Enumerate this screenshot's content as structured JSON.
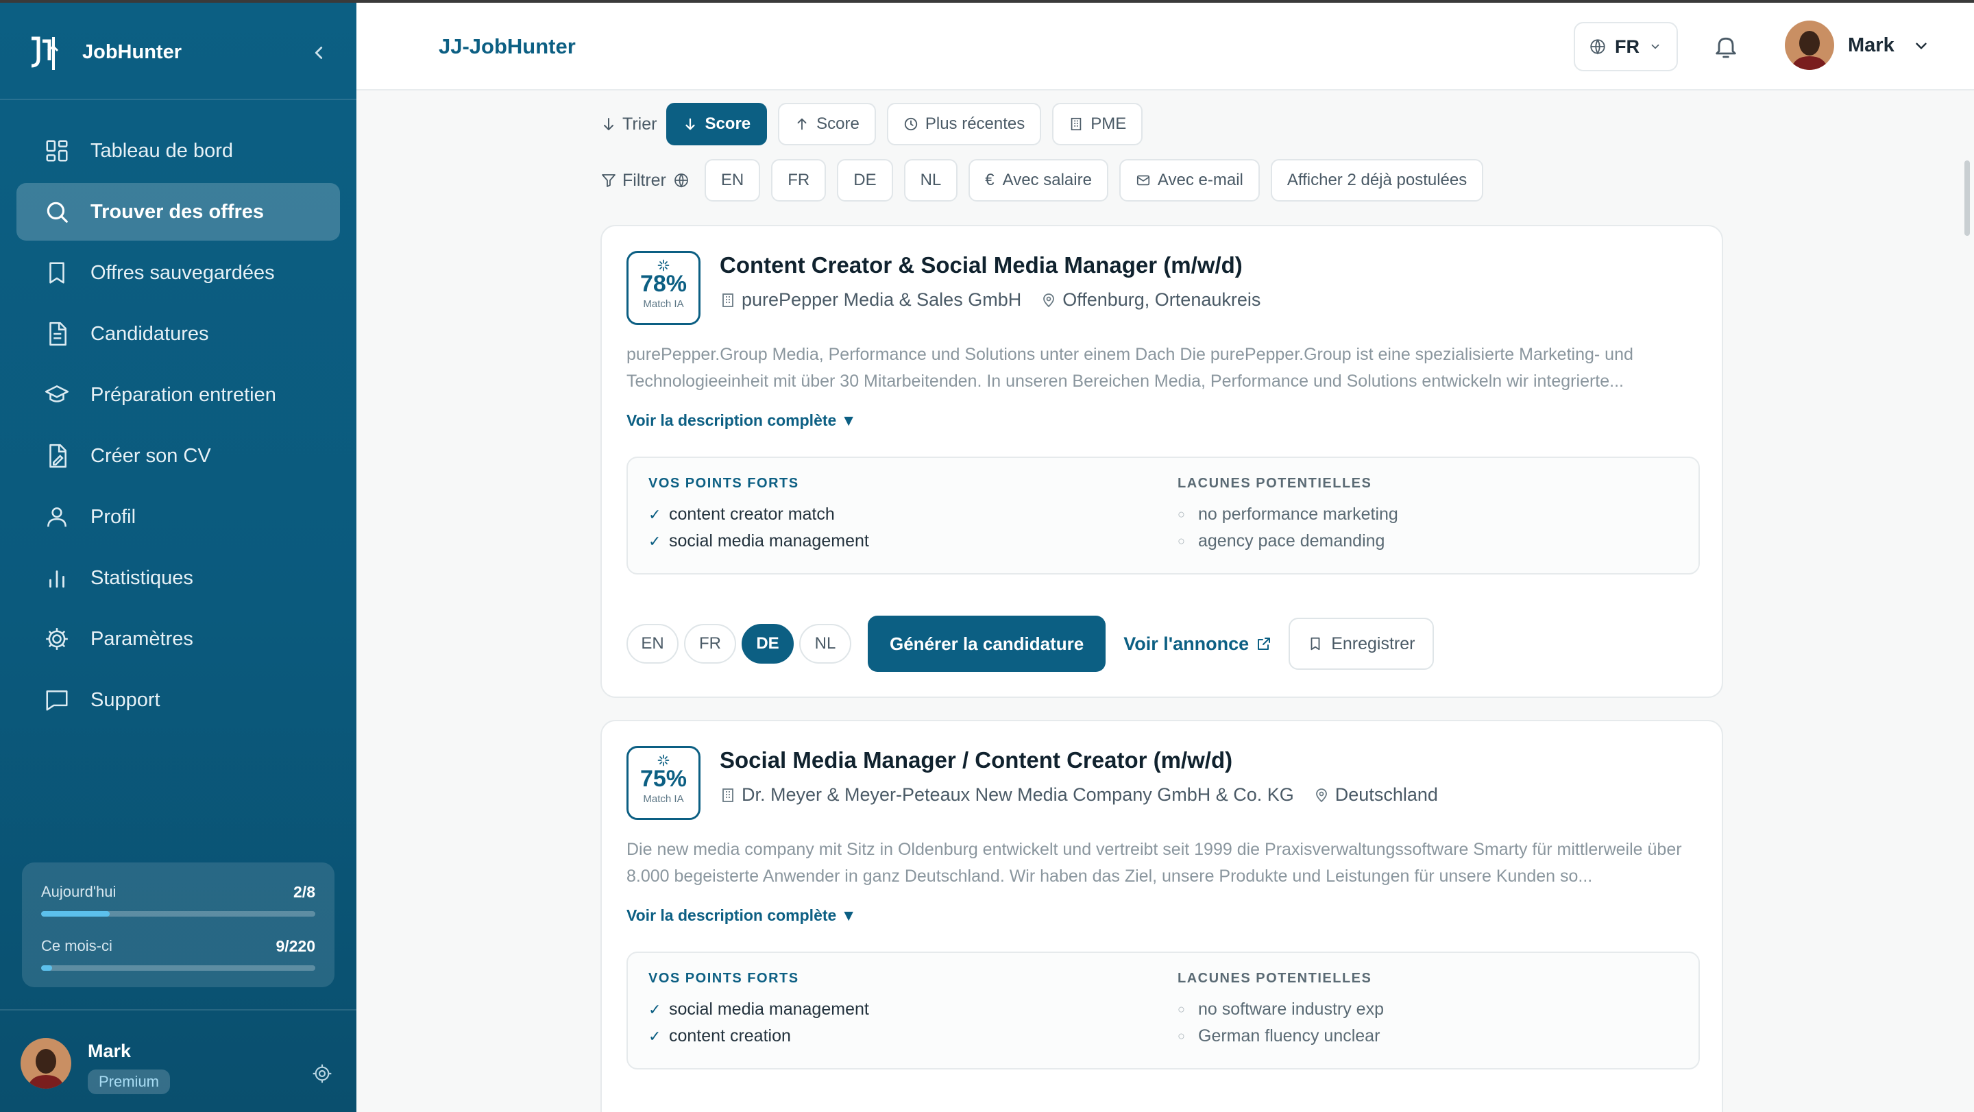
{
  "brand": {
    "name": "JobHunter"
  },
  "sidebar": {
    "items": [
      {
        "label": "Tableau de bord",
        "icon": "dashboard-icon"
      },
      {
        "label": "Trouver des offres",
        "icon": "search-icon",
        "active": true
      },
      {
        "label": "Offres sauvegardées",
        "icon": "bookmark-icon"
      },
      {
        "label": "Candidatures",
        "icon": "document-icon"
      },
      {
        "label": "Préparation entretien",
        "icon": "graduation-cap-icon"
      },
      {
        "label": "Créer son CV",
        "icon": "cv-icon"
      },
      {
        "label": "Profil",
        "icon": "user-icon"
      },
      {
        "label": "Statistiques",
        "icon": "bar-chart-icon"
      },
      {
        "label": "Paramètres",
        "icon": "gear-icon"
      },
      {
        "label": "Support",
        "icon": "chat-icon"
      }
    ],
    "usage": {
      "today_label": "Aujourd'hui",
      "today_value": "2/8",
      "today_fraction": 0.25,
      "month_label": "Ce mois-ci",
      "month_value": "9/220",
      "month_fraction": 0.04
    },
    "user": {
      "name": "Mark",
      "plan": "Premium"
    }
  },
  "header": {
    "title": "JJ-JobHunter",
    "language": "FR",
    "user_name": "Mark"
  },
  "sort": {
    "label": "Trier",
    "options": [
      {
        "label": "Score",
        "icon": "arrow-down-icon",
        "active": true
      },
      {
        "label": "Score",
        "icon": "arrow-up-icon"
      },
      {
        "label": "Plus récentes",
        "icon": "clock-icon"
      },
      {
        "label": "PME",
        "icon": "building-icon"
      }
    ]
  },
  "filter": {
    "label": "Filtrer",
    "languages": [
      "EN",
      "FR",
      "DE",
      "NL"
    ],
    "salary": "Avec salaire",
    "email": "Avec e-mail",
    "applied": "Afficher 2 déjà postulées"
  },
  "jobs": [
    {
      "score": "78%",
      "score_label": "Match IA",
      "title": "Content Creator & Social Media Manager (m/w/d)",
      "company": "purePepper Media & Sales GmbH",
      "location": "Offenburg, Ortenaukreis",
      "description": "purePepper.Group Media, Performance und Solutions unter einem Dach Die purePepper.Group ist eine spezialisierte Marketing- und Technologieeinheit mit über 30 Mitarbeitenden. In unseren Bereichen Media, Performance und Solutions entwickeln wir integrierte...",
      "more_label": "Voir la description complète ▼",
      "strengths_title": "VOS POINTS FORTS",
      "strengths": [
        "content creator match",
        "social media management"
      ],
      "gaps_title": "LACUNES POTENTIELLES",
      "gaps": [
        "no performance marketing",
        "agency pace demanding"
      ],
      "languages": [
        "EN",
        "FR",
        "DE",
        "NL"
      ],
      "selected_language": "DE",
      "generate_label": "Générer la candidature",
      "view_label": "Voir l'annonce",
      "save_label": "Enregistrer"
    },
    {
      "score": "75%",
      "score_label": "Match IA",
      "title": "Social Media Manager / Content Creator (m/w/d)",
      "company": "Dr. Meyer & Meyer-Peteaux New Media Company GmbH & Co. KG",
      "location": "Deutschland",
      "description": "Die new media company mit Sitz in Oldenburg entwickelt und vertreibt seit 1999 die Praxisverwaltungssoftware Smarty für mittlerweile über 8.000 begeisterte Anwender in ganz Deutschland. Wir haben das Ziel, unsere Produkte und Leistungen für unsere Kunden so...",
      "more_label": "Voir la description complète ▼",
      "strengths_title": "VOS POINTS FORTS",
      "strengths": [
        "social media management",
        "content creation"
      ],
      "gaps_title": "LACUNES POTENTIELLES",
      "gaps": [
        "no software industry exp",
        "German fluency unclear"
      ]
    }
  ],
  "colors": {
    "primary": "#0c5f83",
    "sidebar_bg": "#0b5a7d",
    "accent_bar": "#5cc0ec"
  }
}
